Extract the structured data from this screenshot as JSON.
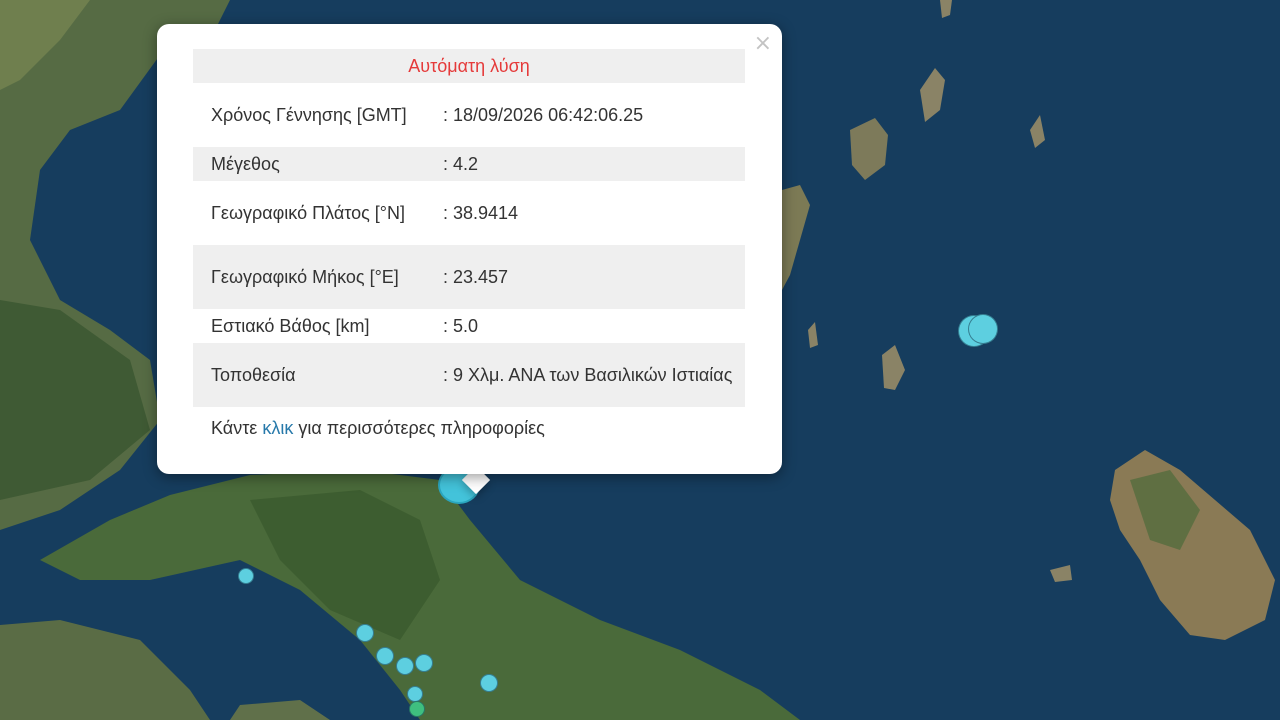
{
  "popup": {
    "title": "Αυτόματη λύση",
    "close_symbol": "×",
    "rows": [
      {
        "label": "Χρόνος Γέννησης [GMT]",
        "value": ": 18/09/2026 06:42:06.25"
      },
      {
        "label": "Μέγεθος",
        "value": ": 4.2"
      },
      {
        "label": "Γεωγραφικό Πλάτος [°N]",
        "value": ": 38.9414"
      },
      {
        "label": "Γεωγραφικό Μήκος [°E]",
        "value": ": 23.457"
      },
      {
        "label": "Εστιακό Βάθος [km]",
        "value": ": 5.0"
      },
      {
        "label": "Τοποθεσία",
        "value": ": 9 Χλμ. ΑΝΑ των Βασιλικών Ιστιαίας"
      }
    ],
    "more_prefix": "Κάντε ",
    "more_link": "κλικ",
    "more_suffix": " για περισσότερες πληροφορίες"
  },
  "colors": {
    "marker": "#5dcfe0",
    "marker_recent": "#3fbf7f",
    "title": "#e53a3a",
    "link": "#2779aa"
  }
}
